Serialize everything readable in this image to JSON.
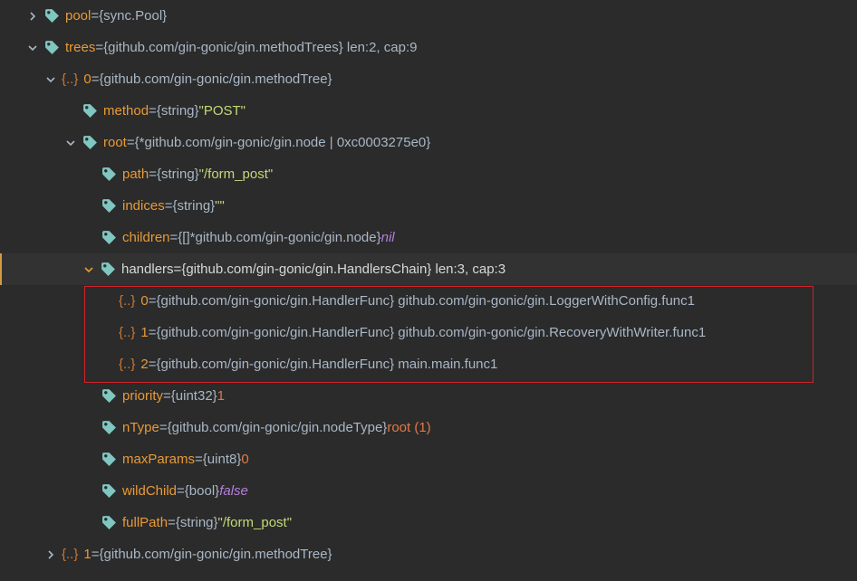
{
  "rows": [
    {
      "name": "pool",
      "eq": " = ",
      "type": "{sync.Pool}"
    },
    {
      "name": "trees",
      "eq": " = ",
      "type": "{github.com/gin-gonic/gin.methodTrees} len:2, cap:9"
    },
    {
      "icon": "{..}",
      "name": "0",
      "eq": " = ",
      "type": "{github.com/gin-gonic/gin.methodTree}"
    },
    {
      "name": "method",
      "eq": " = ",
      "type": "{string} ",
      "value": "\"POST\""
    },
    {
      "name": "root",
      "eq": " = ",
      "type": "{*github.com/gin-gonic/gin.node | 0xc0003275e0}"
    },
    {
      "name": "path",
      "eq": " = ",
      "type": "{string} ",
      "value": "\"/form_post\""
    },
    {
      "name": "indices",
      "eq": " = ",
      "type": "{string} ",
      "value": "\"\""
    },
    {
      "name": "children",
      "eq": " = ",
      "type": "{[]*github.com/gin-gonic/gin.node} ",
      "value": "nil"
    },
    {
      "name": "handlers",
      "eq": " = ",
      "type": "{github.com/gin-gonic/gin.HandlersChain} len:3, cap:3"
    },
    {
      "icon": "{..}",
      "name": "0",
      "eq": " = ",
      "type": "{github.com/gin-gonic/gin.HandlerFunc} github.com/gin-gonic/gin.LoggerWithConfig.func1"
    },
    {
      "icon": "{..}",
      "name": "1",
      "eq": " = ",
      "type": "{github.com/gin-gonic/gin.HandlerFunc} github.com/gin-gonic/gin.RecoveryWithWriter.func1"
    },
    {
      "icon": "{..}",
      "name": "2",
      "eq": " = ",
      "type": "{github.com/gin-gonic/gin.HandlerFunc} main.main.func1"
    },
    {
      "name": "priority",
      "eq": " = ",
      "type": "{uint32} ",
      "value": "1"
    },
    {
      "name": "nType",
      "eq": " = ",
      "type": "{github.com/gin-gonic/gin.nodeType} ",
      "value": "root (1)"
    },
    {
      "name": "maxParams",
      "eq": " = ",
      "type": "{uint8} ",
      "value": "0"
    },
    {
      "name": "wildChild",
      "eq": " = ",
      "type": "{bool} ",
      "value": "false"
    },
    {
      "name": "fullPath",
      "eq": " = ",
      "type": "{string} ",
      "value": "\"/form_post\""
    },
    {
      "icon": "{..}",
      "name": "1",
      "eq": " = ",
      "type": "{github.com/gin-gonic/gin.methodTree}"
    }
  ],
  "colors": {
    "background": "#2b2b2b",
    "field_name": "#e89a36",
    "string_value": "#c3d977",
    "number_value": "#e07a45",
    "keyword_value": "#b57edc",
    "tag_icon": "#7fc7c0",
    "highlight_box": "#d2232a"
  },
  "icons": {
    "field": "tag-icon",
    "expanded": "chevron-down-icon",
    "collapsed": "chevron-right-icon",
    "object": "object-icon"
  }
}
